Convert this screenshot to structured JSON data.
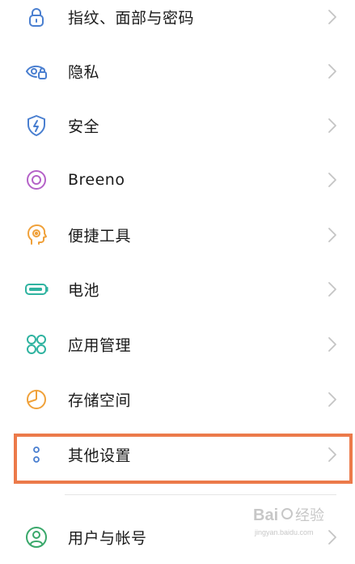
{
  "settings": {
    "items": [
      {
        "label": "指纹、面部与密码",
        "icon": "lock-icon",
        "color": "#4a7fd0"
      },
      {
        "label": "隐私",
        "icon": "privacy-eye-icon",
        "color": "#4a7fd0"
      },
      {
        "label": "安全",
        "icon": "shield-icon",
        "color": "#4a7fd0"
      },
      {
        "label": "Breeno",
        "icon": "breeno-icon",
        "color": "#b562c8"
      },
      {
        "label": "便捷工具",
        "icon": "head-assistant-icon",
        "color": "#f0a13a"
      },
      {
        "label": "电池",
        "icon": "battery-icon",
        "color": "#2fb3a0"
      },
      {
        "label": "应用管理",
        "icon": "apps-grid-icon",
        "color": "#2fb3a0"
      },
      {
        "label": "存储空间",
        "icon": "pie-chart-icon",
        "color": "#f0a13a"
      },
      {
        "label": "其他设置",
        "icon": "more-dots-icon",
        "color": "#4a7fd0"
      },
      {
        "label": "用户与帐号",
        "icon": "user-icon",
        "color": "#3aa86b"
      }
    ]
  },
  "highlight": {
    "color": "#ec7a4a"
  },
  "watermark": {
    "text": "Baidu 经验",
    "subtext": "jingyan.baidu.com"
  }
}
